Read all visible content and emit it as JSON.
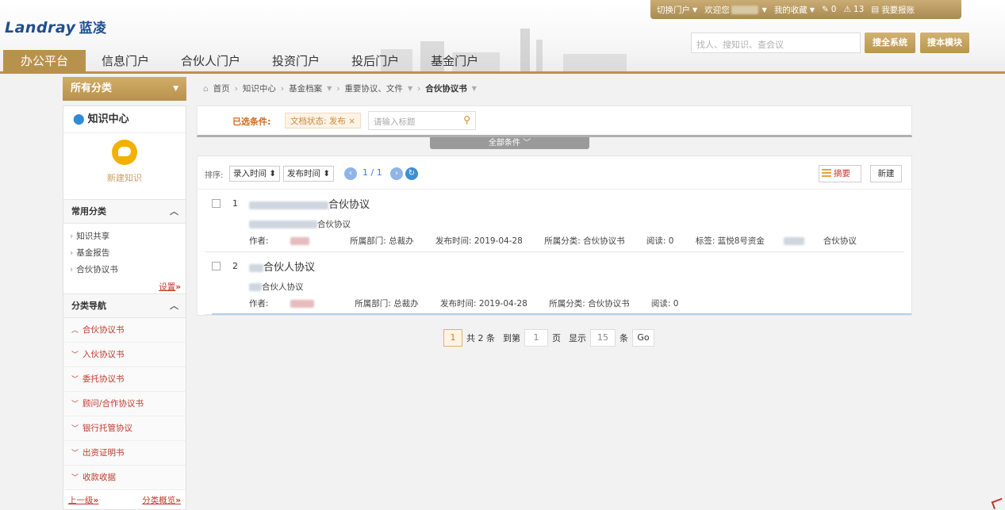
{
  "brand": {
    "logo_en": "Landray",
    "logo_cn": "蓝凌"
  },
  "topbar": {
    "switch_portal": "切换门户",
    "welcome": "欢迎您",
    "favorites": "我的收藏",
    "todo_count": "0",
    "alert_count": "13",
    "report": "我要报账"
  },
  "search": {
    "placeholder": "找人、搜知识、查会议",
    "search_all": "搜全系统",
    "search_module": "搜本模块"
  },
  "nav": {
    "tabs": [
      "办公平台",
      "信息门户",
      "合伙人门户",
      "投资门户",
      "投后门户",
      "基金门户"
    ]
  },
  "sidebar": {
    "header": "所有分类",
    "knowledge_center": "知识中心",
    "new_knowledge": "新建知识",
    "common_header": "常用分类",
    "common_items": [
      "知识共享",
      "基金报告",
      "合伙协议书"
    ],
    "settings": "设置",
    "nav_header": "分类导航",
    "nav_items": [
      "合伙协议书",
      "入伙协议书",
      "委托协议书",
      "顾问/合作协议书",
      "银行托管协议",
      "出资证明书",
      "收款收据"
    ],
    "up_level": "上一级",
    "overview": "分类概览"
  },
  "breadcrumb": [
    "首页",
    "知识中心",
    "基金档案",
    "重要协议、文件",
    "合伙协议书"
  ],
  "filters": {
    "selected_label": "已选条件:",
    "chip": "文档状态: 发布",
    "title_placeholder": "请输入标题",
    "all_conditions": "全部条件"
  },
  "toolbar": {
    "sort_label": "排序:",
    "sort_entry": "录入时间",
    "sort_publish": "发布时间",
    "page_info": "1 / 1",
    "summary": "摘要",
    "new": "新建"
  },
  "rows": [
    {
      "num": "1",
      "title_suffix": "合伙协议",
      "sub_suffix": "合伙协议",
      "author_label": "作者:",
      "dept": "所属部门: 总裁办",
      "pub_date": "发布时间: 2019-04-28",
      "category": "所属分类: 合伙协议书",
      "reads": "阅读: 0",
      "tags_prefix": "标签: 蓝悦8号资金",
      "tags_suffix": "合伙协议"
    },
    {
      "num": "2",
      "title_suffix": "合伙人协议",
      "sub_suffix": "合伙人协议",
      "author_label": "作者:",
      "dept": "所属部门: 总裁办",
      "pub_date": "发布时间: 2019-04-28",
      "category": "所属分类: 合伙协议书",
      "reads": "阅读: 0"
    }
  ],
  "pager": {
    "current": "1",
    "total": "共 2 条",
    "goto_label": "到第",
    "goto_value": "1",
    "page_unit": "页",
    "show_label": "显示",
    "page_size": "15",
    "item_unit": "条",
    "go": "Go"
  }
}
